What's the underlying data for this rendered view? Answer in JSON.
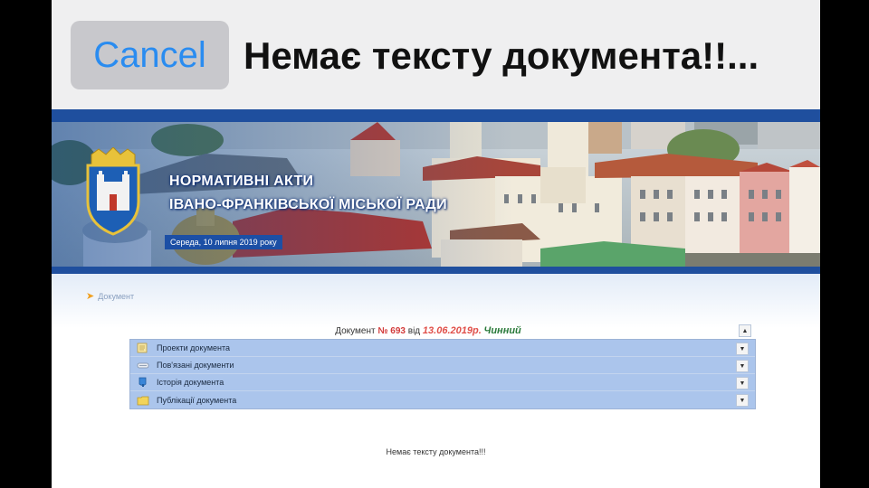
{
  "topbar": {
    "cancel_label": "Cancel",
    "title": "Немає тексту документа!!..."
  },
  "banner": {
    "title_line1": "НОРМАТИВНІ АКТИ",
    "title_line2": "ІВАНО-ФРАНКІВСЬКОЇ МІСЬКОЇ РАДИ",
    "date": "Середа, 10 липня 2019 року"
  },
  "breadcrumb": {
    "item": "Документ"
  },
  "document": {
    "prefix": "Документ",
    "number": "№ 693",
    "from": "від",
    "date": "13.06.2019р.",
    "status": "Чинний",
    "status_color": "#2a7a3a"
  },
  "panel": {
    "rows": [
      {
        "label": "Проекти документа",
        "icon": "folder-doc-icon"
      },
      {
        "label": "Пов'язані документи",
        "icon": "link-icon"
      },
      {
        "label": "Історія документа",
        "icon": "history-icon"
      },
      {
        "label": "Публікації документа",
        "icon": "publication-icon"
      }
    ]
  },
  "body": {
    "message": "Немає тексту документа!!!"
  },
  "colors": {
    "accent": "#1f4f9e",
    "cancel_text": "#2a8cf0",
    "panel_bg": "#abc5ec"
  }
}
